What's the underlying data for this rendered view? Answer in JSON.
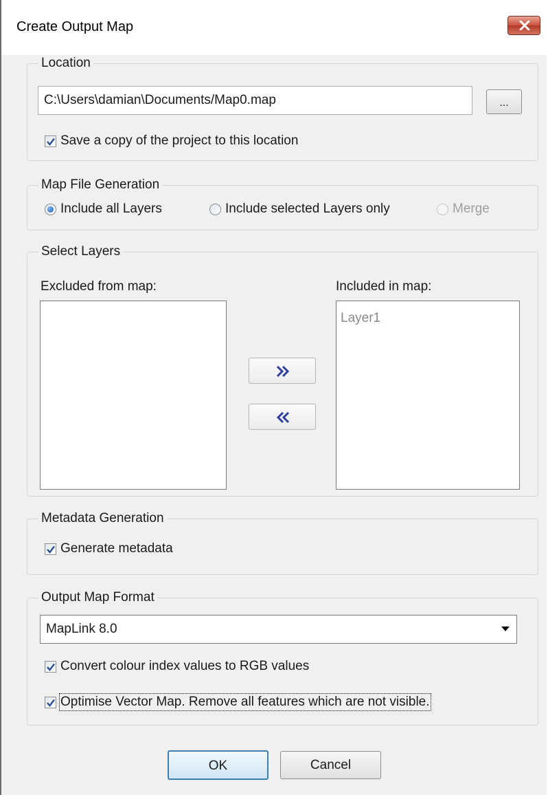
{
  "window": {
    "title": "Create Output Map"
  },
  "location": {
    "legend": "Location",
    "path_value": "C:\\Users\\damian\\Documents/Map0.map",
    "browse_label": "...",
    "save_copy_label": "Save a copy of the project to this location",
    "save_copy_checked": true
  },
  "map_file_generation": {
    "legend": "Map File Generation",
    "options": [
      {
        "label": "Include all Layers",
        "selected": true,
        "enabled": true
      },
      {
        "label": "Include selected Layers only",
        "selected": false,
        "enabled": true
      },
      {
        "label": "Merge",
        "selected": false,
        "enabled": false
      }
    ]
  },
  "select_layers": {
    "legend": "Select Layers",
    "excluded_label": "Excluded from map:",
    "included_label": "Included in map:",
    "excluded_items": [],
    "included_items": [
      "Layer1"
    ],
    "add_icon": "double-chevron-right-icon",
    "remove_icon": "double-chevron-left-icon"
  },
  "metadata": {
    "legend": "Metadata Generation",
    "generate_label": "Generate metadata",
    "generate_checked": true
  },
  "output_format": {
    "legend": "Output Map Format",
    "selected_format": "MapLink 8.0",
    "convert_colour_label": "Convert colour index values to RGB values",
    "convert_colour_checked": true,
    "optimise_label": "Optimise Vector Map. Remove all features which are not visible.",
    "optimise_checked": true
  },
  "buttons": {
    "ok": "OK",
    "cancel": "Cancel"
  }
}
